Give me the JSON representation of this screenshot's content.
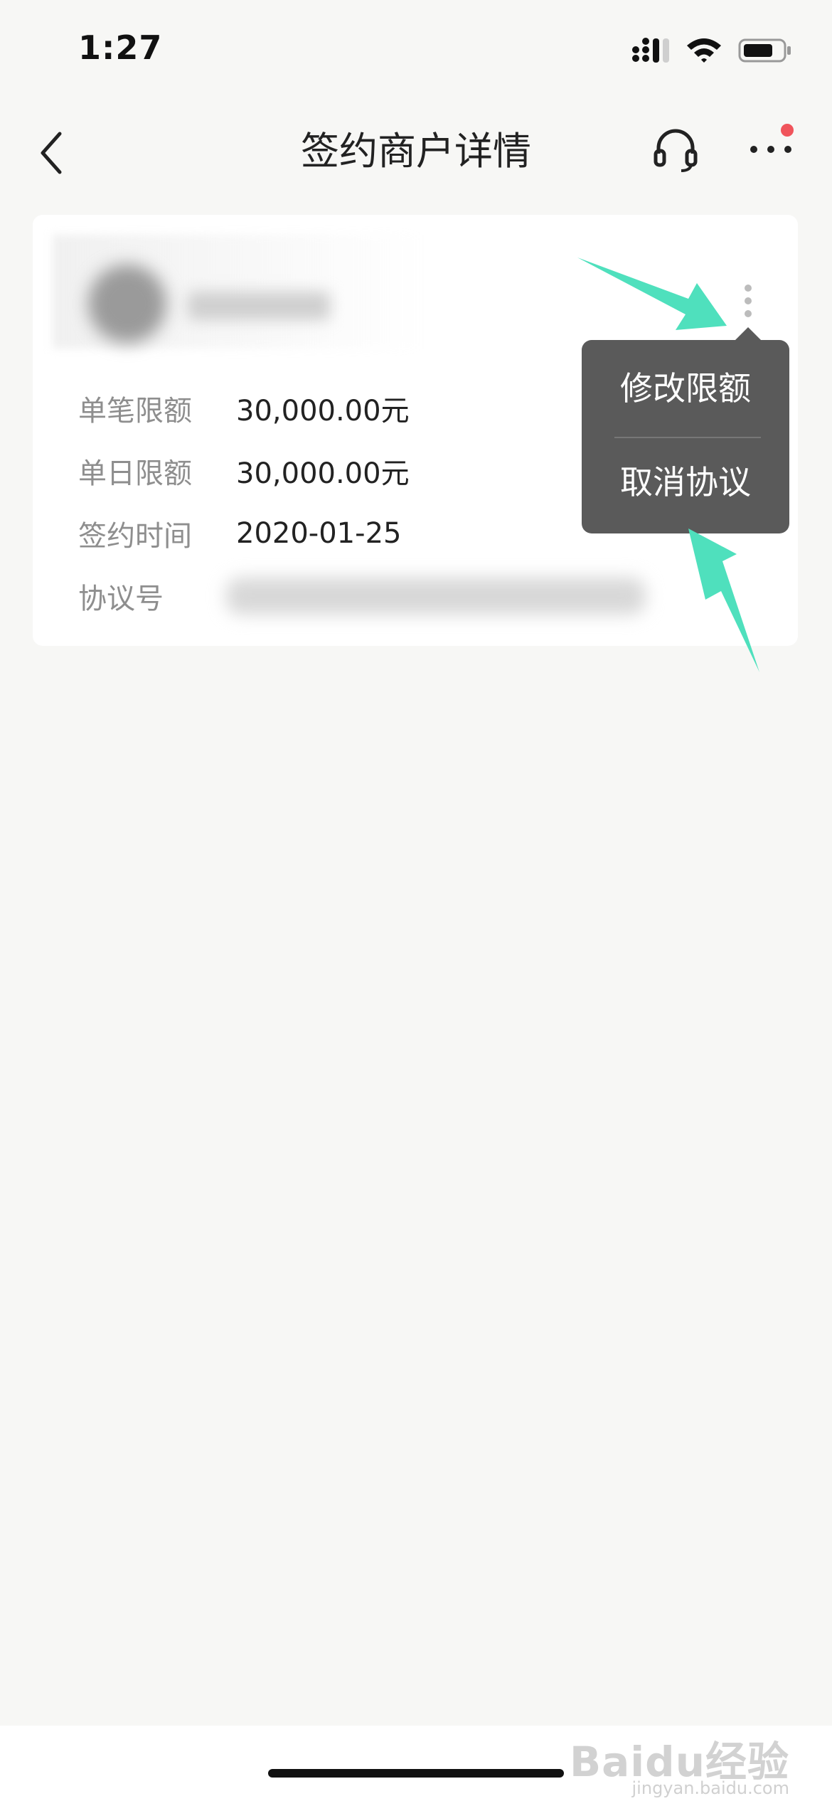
{
  "status_bar": {
    "time": "1:27"
  },
  "nav": {
    "title": "签约商户详情"
  },
  "details": [
    {
      "label": "单笔限额",
      "value": "30,000.00元"
    },
    {
      "label": "单日限额",
      "value": "30,000.00元"
    },
    {
      "label": "签约时间",
      "value": "2020-01-25"
    },
    {
      "label": "协议号",
      "value": ""
    }
  ],
  "menu": {
    "items": [
      "修改限额",
      "取消协议"
    ]
  },
  "watermark": {
    "brand": "Baidu经验",
    "site": "jingyan.baidu.com"
  },
  "colors": {
    "annotation_arrow": "#4fe0bd",
    "notification_dot": "#f0545b",
    "popover_bg": "#5a5a5a"
  }
}
